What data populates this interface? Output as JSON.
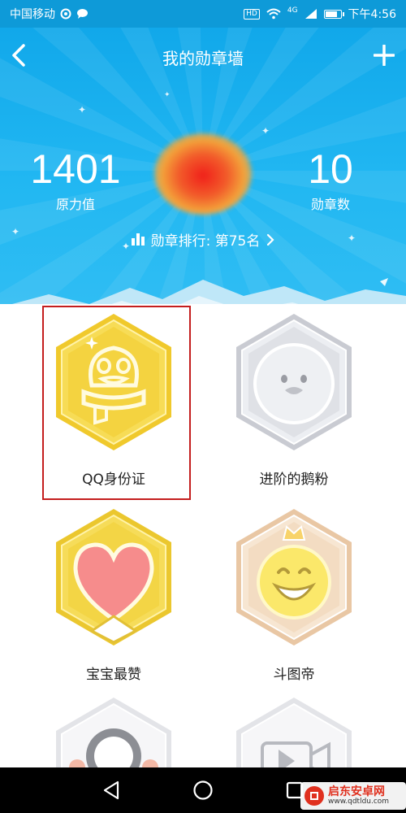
{
  "status_bar": {
    "carrier": "中国移动",
    "time": "下午4:56",
    "hd": "HD",
    "network": "4G",
    "battery_level": 0.8
  },
  "header": {
    "title": "我的勋章墙",
    "back_icon": "chevron-left-icon",
    "add_icon": "plus-icon"
  },
  "stats": {
    "force_value": "1401",
    "force_label": "原力值",
    "medal_count": "10",
    "medal_label": "勋章数"
  },
  "rank": {
    "text": "勋章排行: 第75名",
    "icon": "bar-chart-icon"
  },
  "badges": [
    {
      "label": "QQ身份证",
      "style": "gold",
      "icon": "penguin-scarf-icon"
    },
    {
      "label": "进阶的鹅粉",
      "style": "silver",
      "icon": "penguin-face-icon"
    },
    {
      "label": "宝宝最赞",
      "style": "gold",
      "icon": "heart-icon"
    },
    {
      "label": "斗图帝",
      "style": "peach",
      "icon": "smiley-crown-icon"
    },
    {
      "label": "",
      "style": "white",
      "icon": "paw-icon"
    },
    {
      "label": "",
      "style": "white",
      "icon": "video-icon"
    }
  ],
  "colors": {
    "header_blue": "#21b7f2",
    "highlight_red": "#c41e1e",
    "gold": "#f2d33a",
    "silver": "#d4d6dc"
  },
  "watermark": {
    "title": "启东安卓网",
    "url": "www.qdtldu.com"
  }
}
